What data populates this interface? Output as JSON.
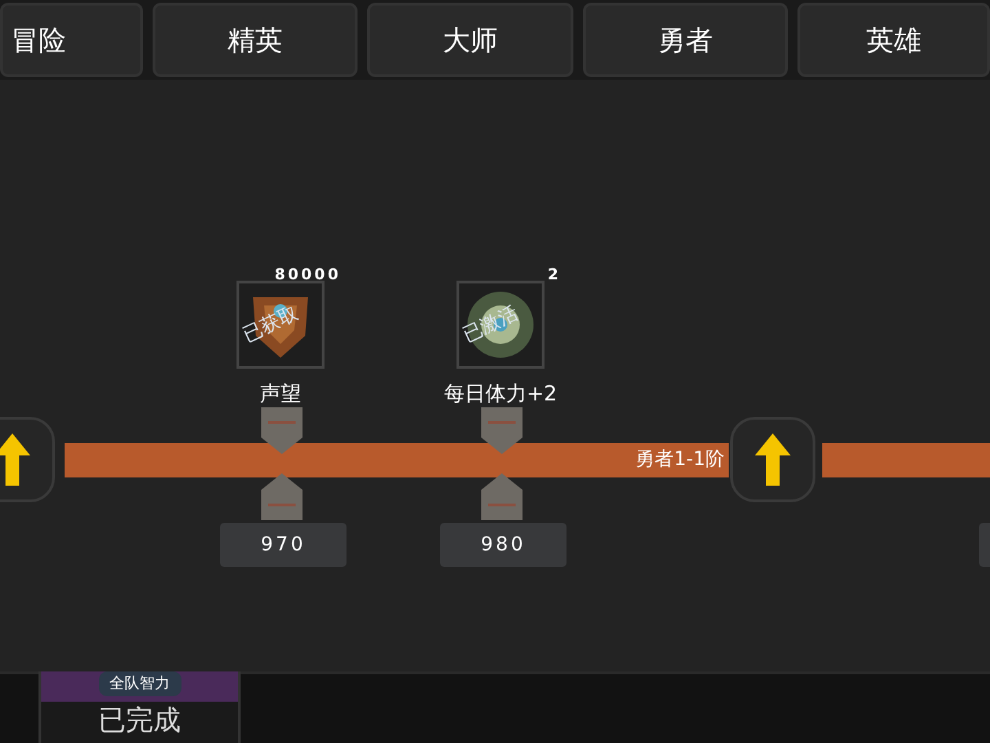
{
  "tabs": [
    {
      "label": "冒险"
    },
    {
      "label": "精英"
    },
    {
      "label": "大师"
    },
    {
      "label": "勇者"
    },
    {
      "label": "英雄"
    }
  ],
  "track": {
    "label": "勇者1-1阶"
  },
  "rewards": [
    {
      "kind": "badge",
      "count": "80000",
      "stamp": "已获取",
      "name": "声望",
      "value": "970"
    },
    {
      "kind": "burst",
      "count": "2",
      "stamp": "已激活",
      "name": "每日体力+2",
      "value": "980"
    }
  ],
  "bottom_card": {
    "tag": "全队智力",
    "status": "已完成"
  }
}
